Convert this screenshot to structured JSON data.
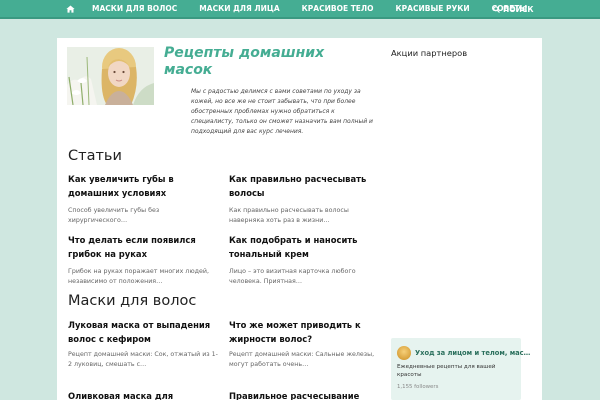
{
  "nav": {
    "home_icon": "home-icon",
    "items": [
      {
        "label": "МАСКИ ДЛЯ ВОЛОС"
      },
      {
        "label": "МАСКИ ДЛЯ ЛИЦА"
      },
      {
        "label": "КРАСИВОЕ ТЕЛО"
      },
      {
        "label": "КРАСИВЫЕ РУКИ"
      },
      {
        "label": "СОВЕТЫ"
      }
    ],
    "search_label": "ПОИСК",
    "search_icon": "search-icon"
  },
  "site": {
    "title": "Рецепты домашних масок",
    "description": "Мы с радостью делимся с вами советами по уходу за кожей, но все же не стоит забывать, что при более обостренных проблемах нужно обратиться к специалисту, только он сможет назначить вам полный и подходящий для вас курс лечения."
  },
  "sections": [
    {
      "title": "Статьи",
      "articles": [
        {
          "title": "Как увеличить губы в домашних условиях",
          "excerpt": "Способ увеличить губы без хирургического…"
        },
        {
          "title": "Как правильно расчесывать волосы",
          "excerpt": "Как правильно расчесывать волосы наверняка хоть раз в жизни…"
        },
        {
          "title": "Что делать если появился грибок на руках",
          "excerpt": "Грибок на руках поражает многих людей, независимо от положения…"
        },
        {
          "title": "Как подобрать и наносить тональный крем",
          "excerpt": "Лицо – это визитная карточка любого человека. Приятная…"
        }
      ]
    },
    {
      "title": "Маски для волос",
      "articles": [
        {
          "title": "Луковая маска от выпадения волос с кефиром",
          "excerpt": "Рецепт домашней маски: Сок, отжатый из 1-2 луковиц, смешать с…"
        },
        {
          "title": "Что же может приводить к жирности волос?",
          "excerpt": "Рецепт домашней маски: Сальные железы, могут работать очень…"
        },
        {
          "title": "Оливковая маска для",
          "excerpt": ""
        },
        {
          "title": "Правильное расчесывание",
          "excerpt": ""
        }
      ]
    }
  ],
  "sidebar": {
    "title": "Акции партнеров"
  },
  "widget": {
    "name": "Уход за лицом и телом, мас…",
    "description": "Ежедневные рецепты для вашей красоты",
    "followers": "1,155 followers"
  },
  "colors": {
    "accent": "#45ad93",
    "background": "#cfe7e0"
  }
}
